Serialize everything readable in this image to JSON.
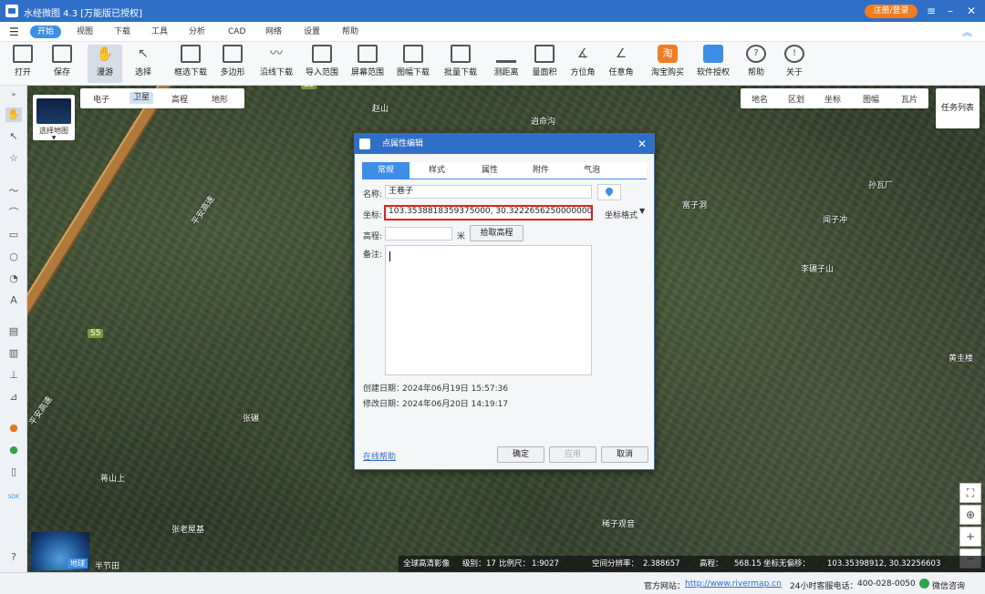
{
  "window": {
    "title": "水经微图 4.3 [万能版已授权]",
    "register": "注册/登录"
  },
  "menu": [
    "开始",
    "视图",
    "下载",
    "工具",
    "分析",
    "CAD",
    "网络",
    "设置",
    "帮助"
  ],
  "toolbar": [
    "打开",
    "保存",
    "漫游",
    "选择",
    "框选下载",
    "多边形",
    "沿线下载",
    "导入范围",
    "屏幕范围",
    "图幅下载",
    "批量下载",
    "测距离",
    "量面积",
    "方位角",
    "任意角",
    "淘宝购买",
    "软件授权",
    "帮助",
    "关于"
  ],
  "map": {
    "tabs": [
      "电子",
      "卫星",
      "高程",
      "地形"
    ],
    "select_map": "选择地图",
    "right_tabs": [
      "地名",
      "区划",
      "坐标",
      "图幅",
      "瓦片"
    ],
    "task_list": "任务列表",
    "labels": [
      "赵山",
      "逍命沟",
      "富子洞",
      "孙瓦厂",
      "闻子冲",
      "李碾子山",
      "张碾",
      "蒋山上",
      "张老屋基",
      "稀子观音",
      "黄圭楼"
    ],
    "road_labels": [
      "平安高速",
      "平安高速"
    ],
    "road_badges": [
      "S5",
      "S5"
    ],
    "globe": {
      "label": "地球",
      "extra": "半节田"
    },
    "status": {
      "source": "全球高清影像",
      "level_label": "级别：",
      "level": "17",
      "scale_label": "比例尺：",
      "scale": "1:9027",
      "res_label": "空间分辨率：",
      "res": "2.388657",
      "elev_label": "高程：",
      "elev": "568.15",
      "coord_label": "坐标无偏移：",
      "coord": "103.35398912, 30.32256603"
    }
  },
  "dialog": {
    "title": "点属性编辑",
    "tabs": [
      "常规",
      "样式",
      "属性",
      "附件",
      "气泡"
    ],
    "name_label": "名称:",
    "name": "王巷子",
    "coord_label": "坐标:",
    "coord": "103.3538818359375000, 30.3222656250000000",
    "coord_format": "坐标格式",
    "elev_label": "高程:",
    "elev": "",
    "elev_unit": "米",
    "pick_elev": "拾取高程",
    "note_label": "备注:",
    "note": "",
    "created_label": "创建日期：",
    "created": "2024年06月19日 15:57:36",
    "modified_label": "修改日期：",
    "modified": "2024年06月20日 14:19:17",
    "help": "在线帮助",
    "ok": "确定",
    "apply": "应用",
    "cancel": "取消"
  },
  "statusbar": {
    "site_label": "官方网站：",
    "site": "http://www.rivermap.cn",
    "phone_label": "24小时客服电话：",
    "phone": "400-028-0050",
    "wechat": "微信咨询"
  },
  "colors": {
    "accent": "#2f6fc8",
    "register": "#f07d22",
    "highlight": "#e02020"
  }
}
